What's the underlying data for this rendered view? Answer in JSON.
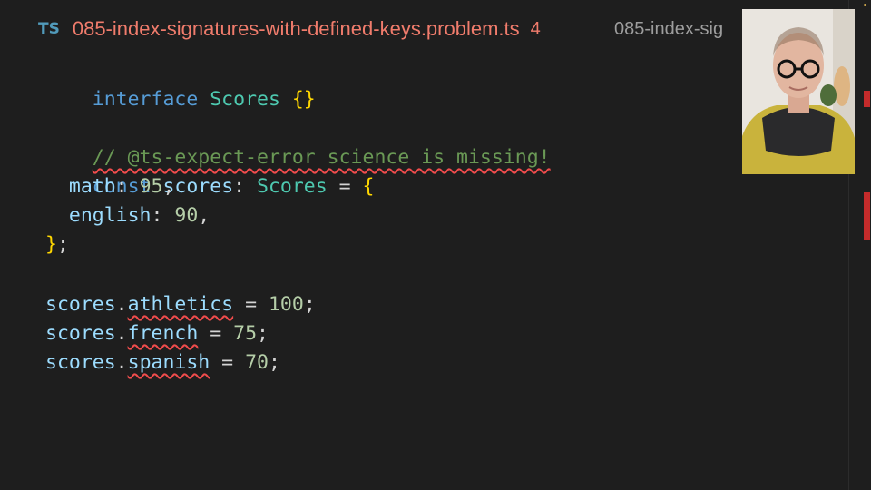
{
  "tabs": {
    "active": {
      "badge": "TS",
      "title": "085-index-signatures-with-defined-keys.problem.ts",
      "problems": "4"
    },
    "inactive": {
      "title": "085-index-sig"
    }
  },
  "code": {
    "l1": {
      "kw": "interface",
      "name": "Scores",
      "brace": "{}"
    },
    "l3": {
      "comment": "// @ts-expect-error science is missing!"
    },
    "l4": {
      "kw": "const",
      "var": "scores",
      "colon": ": ",
      "type": "Scores",
      "eq": " = ",
      "brace": "{"
    },
    "l5": {
      "prop": "math",
      "colon": ": ",
      "num": "95",
      "comma": ","
    },
    "l6": {
      "prop": "english",
      "colon": ": ",
      "num": "90",
      "comma": ","
    },
    "l7": {
      "brace": "}",
      "semi": ";"
    },
    "l9": {
      "obj": "scores",
      "dot": ".",
      "prop": "athletics",
      "eq": " = ",
      "num": "100",
      "semi": ";"
    },
    "l10": {
      "obj": "scores",
      "dot": ".",
      "prop": "french",
      "eq": " = ",
      "num": "75",
      "semi": ";"
    },
    "l11": {
      "obj": "scores",
      "dot": ".",
      "prop": "spanish",
      "eq": " = ",
      "num": "70",
      "semi": ";"
    }
  },
  "colors": {
    "background": "#1e1e1e",
    "error": "#f14c4c",
    "tab_error_title": "#f07c6c",
    "ts_badge": "#519aba"
  },
  "icons": {
    "webcam": "presenter-webcam-overlay"
  }
}
